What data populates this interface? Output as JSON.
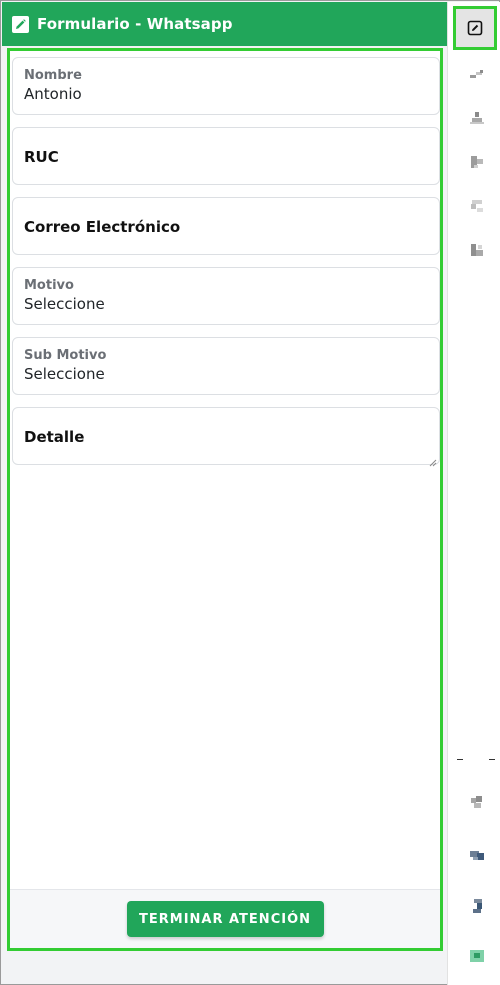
{
  "header": {
    "title": "Formulario - Whatsapp",
    "icon": "edit-icon",
    "color": "#21a65a"
  },
  "form": {
    "fields": [
      {
        "name": "nombre",
        "label": "Nombre",
        "value": "Antonio"
      },
      {
        "name": "ruc",
        "label": "RUC"
      },
      {
        "name": "correo",
        "label": "Correo Electrónico"
      },
      {
        "name": "motivo",
        "label": "Motivo",
        "value": "Seleccione"
      },
      {
        "name": "submotivo",
        "label": "Sub Motivo",
        "value": "Seleccione"
      },
      {
        "name": "detalle",
        "label": "Detalle"
      }
    ],
    "submit_label": "TERMINAR ATENCIÓN"
  },
  "toolbar": {
    "active_icon": "edit-square-icon",
    "icons": [
      "link-icon",
      "user-icon",
      "share-icon",
      "refresh-icon",
      "chart-icon",
      "tools-icon",
      "chat-icon",
      "phone-icon",
      "image-icon"
    ]
  },
  "colors": {
    "accent": "#21a65a",
    "highlight": "#33cc33"
  }
}
